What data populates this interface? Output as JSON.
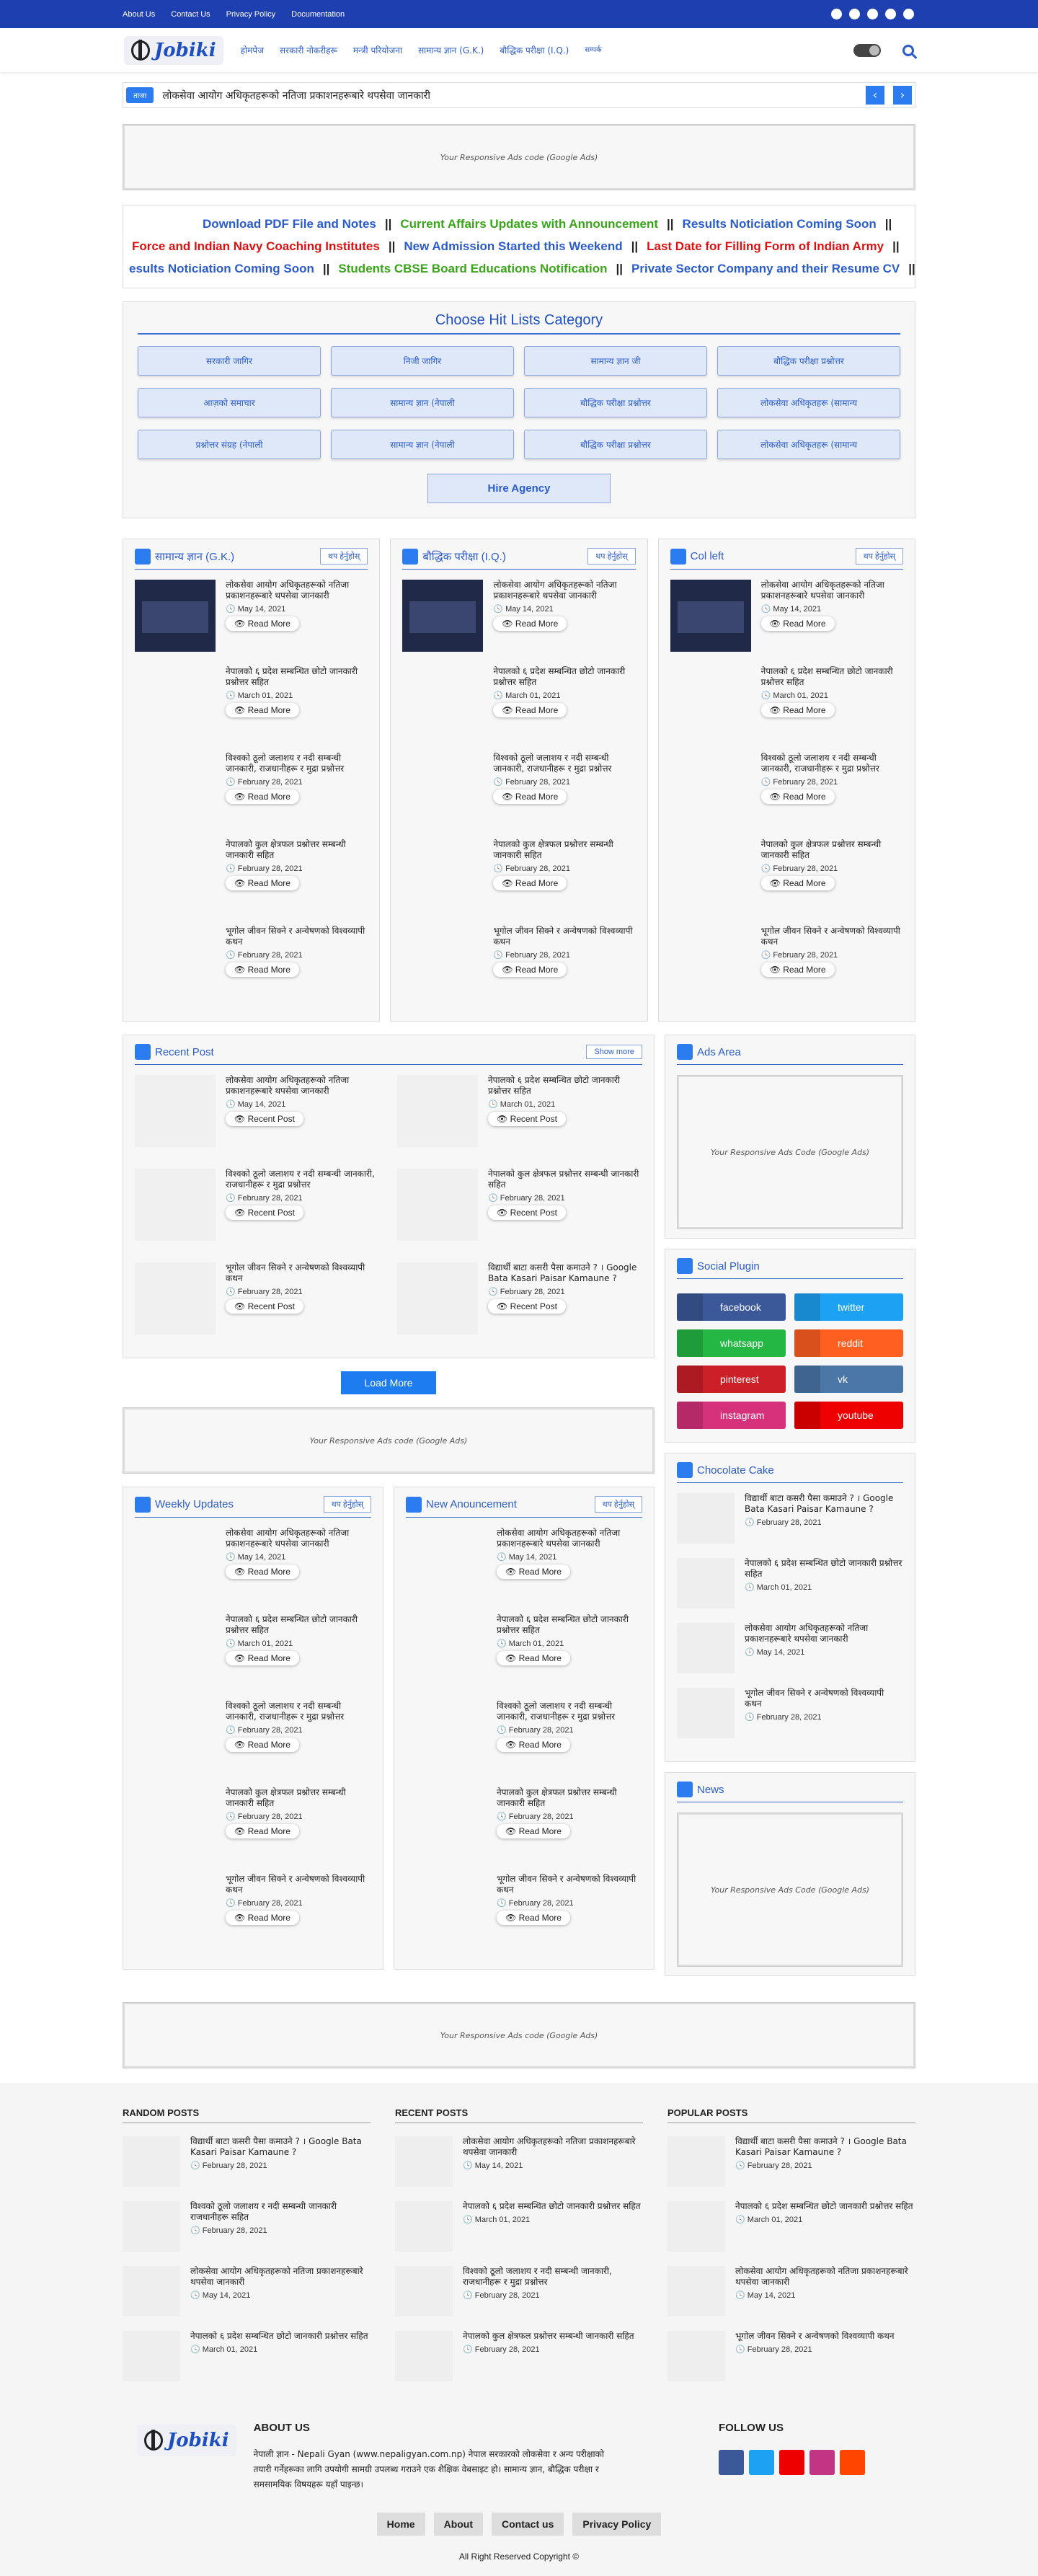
{
  "topbar": {
    "links": [
      "About Us",
      "Contact Us",
      "Privacy Policy",
      "Documentation"
    ],
    "social_icons": [
      "facebook-icon",
      "whatsapp-icon",
      "telegram-icon",
      "twitter-icon",
      "instagram-icon"
    ]
  },
  "header": {
    "logo": "Jobiki",
    "nav": [
      "होमपेज",
      "सरकारी नोकरीहरू",
      "मन्त्री परियोजना",
      "सामान्य ज्ञान (G.K.)",
      "बौद्धिक परीक्षा (I.Q.)",
      "सम्पर्क"
    ]
  },
  "ticker": {
    "label": "ताजा",
    "text": "लोकसेवा आयोग अधिकृतहरूको नतिजा प्रकाशनहरूबारे थपसेवा जानकारी",
    "prev": "‹",
    "next": "›"
  },
  "ads": {
    "top": "Your Responsive Ads code (Google Ads)",
    "area": "Your Responsive Ads Code (Google Ads)",
    "mid": "Your Responsive Ads code (Google Ads)",
    "news": "Your Responsive Ads Code (Google Ads)",
    "bottom": "Your Responsive Ads code (Google Ads)"
  },
  "marquee": {
    "row1": [
      {
        "t": "Download PDF File and Notes",
        "c": "blue"
      },
      {
        "t": "||",
        "c": "dark"
      },
      {
        "t": "Current Affairs Updates with Announcement",
        "c": "green"
      },
      {
        "t": "||",
        "c": "dark"
      },
      {
        "t": "Results Noticiation Coming Soon",
        "c": "blue"
      },
      {
        "t": "||",
        "c": "dark"
      }
    ],
    "row2": [
      {
        "t": "Force and Indian Navy Coaching Institutes",
        "c": "red"
      },
      {
        "t": "||",
        "c": "dark"
      },
      {
        "t": "New Admission Started this Weekend",
        "c": "blue"
      },
      {
        "t": "||",
        "c": "dark"
      },
      {
        "t": "Last Date for Filling Form of Indian Army",
        "c": "red"
      },
      {
        "t": "||",
        "c": "dark"
      }
    ],
    "row3": [
      {
        "t": "esults Noticiation Coming Soon",
        "c": "blue"
      },
      {
        "t": "||",
        "c": "dark"
      },
      {
        "t": "Students CBSE Board Educations Notification",
        "c": "green"
      },
      {
        "t": "||",
        "c": "dark"
      },
      {
        "t": "Private Sector Company and their Resume CV",
        "c": "blue"
      },
      {
        "t": "||",
        "c": "dark"
      }
    ]
  },
  "category": {
    "title": "Choose Hit Lists Category",
    "buttons": [
      "सरकारी जागिर",
      "निजी जागिर",
      "सामान्य ज्ञान जी",
      "बौद्धिक परीक्षा प्रश्नोत्तर",
      "आज़को समाचार",
      "सामान्य ज्ञान (नेपाली",
      "बौद्धिक परीक्षा प्रश्नोत्तर",
      "लोकसेवा अधिकृतहरू (सामान्य",
      "प्रश्नोत्तर संग्रह (नेपाली",
      "सामान्य ज्ञान (नेपाली",
      "बौद्धिक परीक्षा प्रश्नोत्तर",
      "लोकसेवा अधिकृतहरू (सामान्य"
    ],
    "hire": "Hire Agency"
  },
  "posts": [
    {
      "title": "लोकसेवा आयोग अधिकृतहरूको नतिजा प्रकाशनहरूबारे थपसेवा जानकारी",
      "date": "May 14, 2021"
    },
    {
      "title": "नेपालको ६ प्रदेश सम्बन्धित छोटो जानकारी प्रश्नोत्तर सहित",
      "date": "March 01, 2021"
    },
    {
      "title": "विश्वको ठूलो जलाशय र नदी सम्बन्धी जानकारी, राजधानीहरू र मुद्रा प्रश्नोत्तर",
      "date": "February 28, 2021"
    },
    {
      "title": "नेपालको कुल क्षेत्रफल प्रश्नोत्तर सम्बन्धी जानकारी सहित",
      "date": "February 28, 2021"
    },
    {
      "title": "भूगोल जीवन सिक्ने र अन्वेषणको विश्वव्यापी कथन",
      "date": "February 28, 2021"
    }
  ],
  "columns": {
    "gk": "सामान्य ज्ञान (G.K.)",
    "iq": "बौद्धिक परीक्षा (I.Q.)",
    "col": "Col left",
    "more": "थप हेर्नुहोस्",
    "read": "Read More"
  },
  "recent": {
    "title": "Recent Post",
    "more": "Show more",
    "btn": "Recent Post",
    "load": "Load More",
    "items": [
      {
        "title": "लोकसेवा आयोग अधिकृतहरूको नतिजा प्रकाशनहरूबारे थपसेवा जानकारी",
        "date": "May 14, 2021"
      },
      {
        "title": "नेपालको ६ प्रदेश सम्बन्धित छोटो जानकारी प्रश्नोत्तर सहित",
        "date": "March 01, 2021"
      },
      {
        "title": "विश्वको ठूलो जलाशय र नदी सम्बन्धी जानकारी, राजधानीहरू र मुद्रा प्रश्नोत्तर",
        "date": "February 28, 2021"
      },
      {
        "title": "नेपालको कुल क्षेत्रफल प्रश्नोत्तर सम्बन्धी जानकारी सहित",
        "date": "February 28, 2021"
      },
      {
        "title": "भूगोल जीवन सिक्ने र अन्वेषणको विश्वव्यापी कथन",
        "date": "February 28, 2021"
      },
      {
        "title": "विद्यार्थी बाटा कसरी पैसा कमाउने ? । Google Bata Kasari Paisar Kamaune ?",
        "date": "February 28, 2021"
      }
    ]
  },
  "sidebar": {
    "ads_title": "Ads Area",
    "social_title": "Social Plugin",
    "social": [
      {
        "n": "facebook",
        "c": "#3b5998"
      },
      {
        "n": "twitter",
        "c": "#1da1f2"
      },
      {
        "n": "whatsapp",
        "c": "#25b744"
      },
      {
        "n": "reddit",
        "c": "#ff5f1f"
      },
      {
        "n": "pinterest",
        "c": "#cb2027"
      },
      {
        "n": "vk",
        "c": "#4a76a8"
      },
      {
        "n": "instagram",
        "c": "#d6317b"
      },
      {
        "n": "youtube",
        "c": "#e00"
      }
    ],
    "cake_title": "Chocolate Cake",
    "cake": [
      {
        "title": "विद्यार्थी बाटा कसरी पैसा कमाउने ? । Google Bata Kasari Paisar Kamaune ?",
        "date": "February 28, 2021"
      },
      {
        "title": "नेपालको ६ प्रदेश सम्बन्धित छोटो जानकारी प्रश्नोत्तर सहित",
        "date": "March 01, 2021"
      },
      {
        "title": "लोकसेवा आयोग अधिकृतहरूको नतिजा प्रकाशनहरूबारे थपसेवा जानकारी",
        "date": "May 14, 2021"
      },
      {
        "title": "भूगोल जीवन सिक्ने र अन्वेषणको विश्वव्यापी कथन",
        "date": "February 28, 2021"
      }
    ],
    "news_title": "News"
  },
  "bottom_cols": {
    "weekly": "Weekly Updates",
    "announce": "New Anouncement"
  },
  "footer": {
    "random_title": "RANDOM POSTS",
    "recent_title": "RECENT POSTS",
    "popular_title": "POPULAR POSTS",
    "random": [
      {
        "title": "विद्यार्थी बाटा कसरी पैसा कमाउने ? । Google Bata Kasari Paisar Kamaune ?",
        "date": "February 28, 2021"
      },
      {
        "title": "विश्वको ठूलो जलाशय र नदी सम्बन्धी जानकारी राजधानीहरू सहित",
        "date": "February 28, 2021"
      },
      {
        "title": "लोकसेवा आयोग अधिकृतहरूको नतिजा प्रकाशनहरूबारे थपसेवा जानकारी",
        "date": "May 14, 2021"
      },
      {
        "title": "नेपालको ६ प्रदेश सम्बन्धित छोटो जानकारी प्रश्नोत्तर सहित",
        "date": "March 01, 2021"
      }
    ],
    "recent": [
      {
        "title": "लोकसेवा आयोग अधिकृतहरूको नतिजा प्रकाशनहरूबारे थपसेवा जानकारी",
        "date": "May 14, 2021"
      },
      {
        "title": "नेपालको ६ प्रदेश सम्बन्धित छोटो जानकारी प्रश्नोत्तर सहित",
        "date": "March 01, 2021"
      },
      {
        "title": "विश्वको ठूलो जलाशय र नदी सम्बन्धी जानकारी, राजधानीहरू र मुद्रा प्रश्नोत्तर",
        "date": "February 28, 2021"
      },
      {
        "title": "नेपालको कुल क्षेत्रफल प्रश्नोत्तर सम्बन्धी जानकारी सहित",
        "date": "February 28, 2021"
      }
    ],
    "popular": [
      {
        "title": "विद्यार्थी बाटा कसरी पैसा कमाउने ? । Google Bata Kasari Paisar Kamaune ?",
        "date": "February 28, 2021"
      },
      {
        "title": "नेपालको ६ प्रदेश सम्बन्धित छोटो जानकारी प्रश्नोत्तर सहित",
        "date": "March 01, 2021"
      },
      {
        "title": "लोकसेवा आयोग अधिकृतहरूको नतिजा प्रकाशनहरूबारे थपसेवा जानकारी",
        "date": "May 14, 2021"
      },
      {
        "title": "भूगोल जीवन सिक्ने र अन्वेषणको विश्वव्यापी कथन",
        "date": "February 28, 2021"
      }
    ],
    "about_title": "ABOUT US",
    "about_text": "नेपाली ज्ञान - Nepali Gyan (www.nepaligyan.com.np) नेपाल सरकारको लोकसेवा र अन्य परीक्षाको तयारी गर्नेहरूका लागि उपयोगी सामग्री उपलब्ध गराउने एक शैक्षिक वेबसाइट हो। सामान्य ज्ञान, बौद्धिक परीक्षा र समसामयिक विषयहरू यहाँ पाइन्छ।",
    "follow_title": "FOLLOW US",
    "follow_icons": [
      {
        "n": "facebook-icon",
        "c": "#3b5998"
      },
      {
        "n": "twitter-icon",
        "c": "#1da1f2"
      },
      {
        "n": "youtube-icon",
        "c": "#e00"
      },
      {
        "n": "instagram-icon",
        "c": "#c13584"
      },
      {
        "n": "reddit-icon",
        "c": "#ff4500"
      }
    ],
    "menu": [
      "Home",
      "About",
      "Contact us",
      "Privacy Policy"
    ],
    "copyright": "All Right Reserved Copyright ©"
  }
}
